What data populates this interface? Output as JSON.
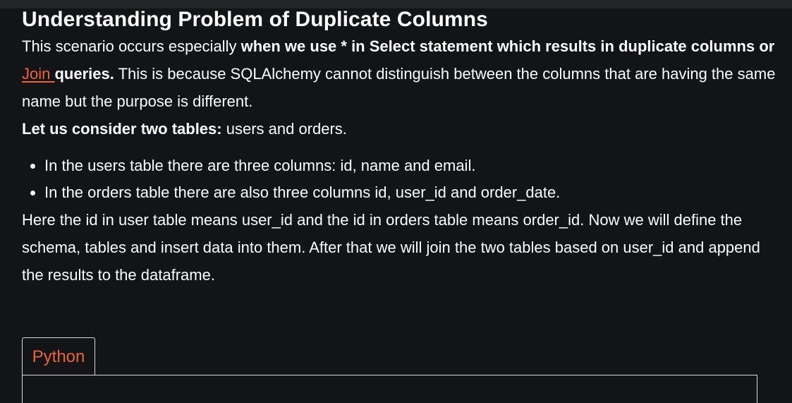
{
  "article": {
    "title": "Understanding Problem of Duplicate Columns",
    "p1": {
      "text1": "This scenario occurs especially ",
      "bold1": "when we use * in Select statement which results in duplicate columns or ",
      "link": "Join ",
      "bold2": "queries.",
      "text2": " This is because SQLAlchemy cannot distinguish between the columns that are having the same name but the purpose is different."
    },
    "p2": {
      "bold": "Let us consider two tables:",
      "text": " users and orders."
    },
    "bullets": [
      "In the users table there are three columns: id, name and email.",
      "In the orders table there are also three columns id, user_id and order_date."
    ],
    "p3": "Here the id in user table means user_id and the id in orders table means order_id. Now we will define the schema, tables and insert data into them. After that we will join the two tables based on user_id and append the results to the dataframe."
  },
  "code_tabs": {
    "active_label": "Python"
  },
  "colors": {
    "background": "#131417",
    "accent": "#f0642c",
    "text": "#ffffff"
  }
}
